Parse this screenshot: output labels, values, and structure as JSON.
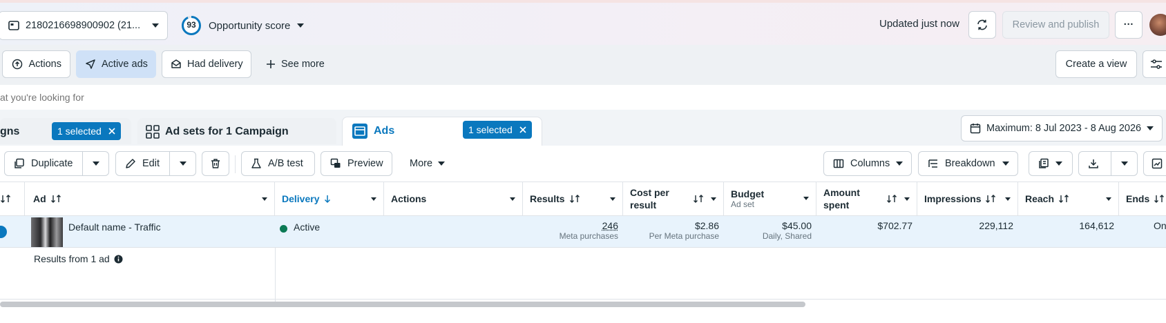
{
  "topbar": {
    "account_label": "2180216698900902 (21...",
    "opportunity_score": "93",
    "opportunity_label": "Opportunity score",
    "updated_text": "Updated just now",
    "review_publish": "Review and publish",
    "more_dots": "···"
  },
  "filters": {
    "actions": "Actions",
    "active_ads": "Active ads",
    "had_delivery": "Had delivery",
    "see_more": "See more",
    "create_view": "Create a view"
  },
  "search": {
    "placeholder": "at you're looking for"
  },
  "tabs": {
    "campaigns": "gns",
    "campaigns_selected": "1 selected",
    "adsets": "Ad sets for 1 Campaign",
    "ads": "Ads",
    "ads_selected": "1 selected",
    "date_range": "Maximum: 8 Jul 2023 - 8 Aug 2026"
  },
  "toolbar": {
    "duplicate": "Duplicate",
    "edit": "Edit",
    "ab_test": "A/B test",
    "preview": "Preview",
    "more": "More",
    "columns": "Columns",
    "breakdown": "Breakdown"
  },
  "table": {
    "headers": {
      "ad": "Ad",
      "delivery": "Delivery",
      "actions": "Actions",
      "results": "Results",
      "cost_per_result": "Cost per result",
      "budget": "Budget",
      "budget_sub": "Ad set",
      "amount_spent": "Amount spent",
      "impressions": "Impressions",
      "reach": "Reach",
      "ends": "Ends"
    },
    "row": {
      "ad_name": "Default name - Traffic",
      "delivery": "Active",
      "results": "246",
      "results_sub": "Meta purchases",
      "cost_per_result": "$2.86",
      "cost_sub": "Per Meta purchase",
      "budget": "$45.00",
      "budget_sub": "Daily, Shared",
      "amount_spent": "$702.77",
      "impressions": "229,112",
      "reach": "164,612",
      "ends": "On"
    },
    "summary": "Results from 1 ad"
  },
  "colors": {
    "accent": "#0a78be",
    "active_green": "#0b7a55",
    "selected_filter": "#cfe1f7"
  }
}
